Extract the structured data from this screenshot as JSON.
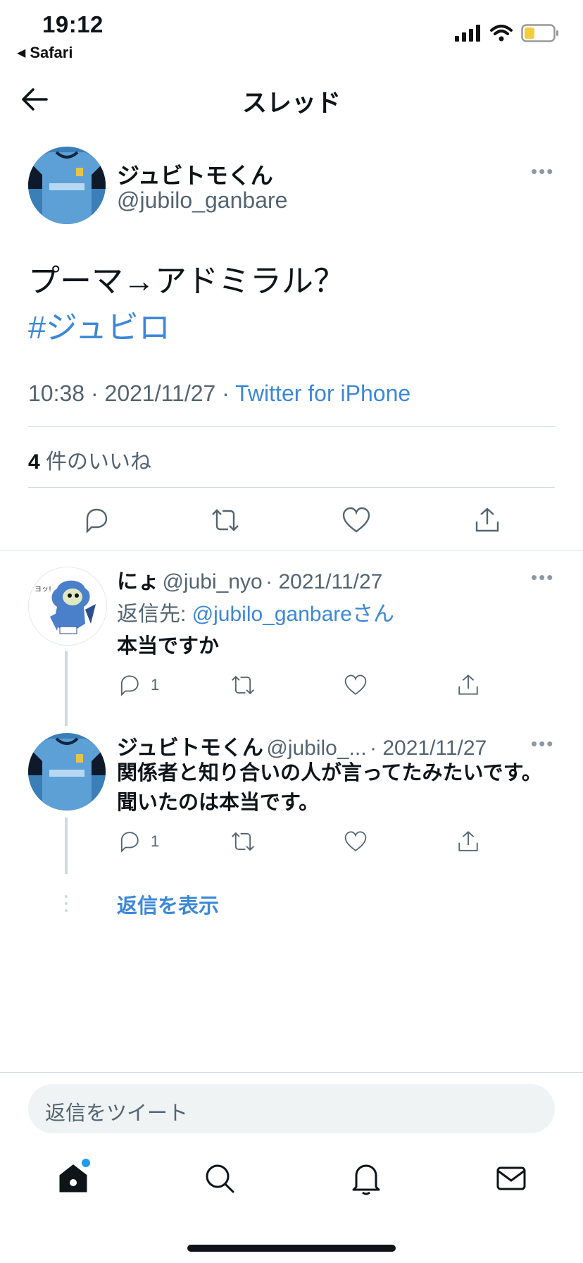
{
  "status_bar": {
    "time": "19:12",
    "back_app": "Safari",
    "icons": [
      "signal-icon",
      "wifi-icon",
      "battery-icon"
    ]
  },
  "header": {
    "title": "スレッド",
    "back_icon": "arrow-left-icon"
  },
  "main_tweet": {
    "display_name": "ジュビトモくん",
    "handle": "@jubilo_ganbare",
    "text": "プーマ→アドミラル？",
    "hashtag": "#ジュビロ",
    "time": "10:38",
    "date": "2021/11/27",
    "source": "Twitter for iPhone",
    "likes_count": "4",
    "likes_label": "件のいいね",
    "actions": [
      "reply-icon",
      "retweet-icon",
      "like-icon",
      "share-icon"
    ]
  },
  "replies": [
    {
      "display_name": "にょ",
      "handle": "@jubi_nyo",
      "date": "· 2021/11/27",
      "reply_to_label": "返信先:",
      "reply_to_handle": "@jubilo_ganbare",
      "reply_to_suffix": "さん",
      "text": "本当ですか",
      "reply_count": "1"
    },
    {
      "display_name": "ジュビトモくん",
      "handle": "@jubilo_...",
      "date": "· 2021/11/27",
      "text_line1": "関係者と知り合いの人が言ってたみたいです。",
      "text_line2": "聞いたのは本当です。",
      "reply_count": "1"
    }
  ],
  "show_replies_label": "返信を表示",
  "reply_placeholder": "返信をツイート",
  "tab_bar": [
    "home-icon",
    "search-icon",
    "bell-icon",
    "mail-icon"
  ],
  "colors": {
    "link": "#3b88d8",
    "muted": "#536471",
    "notification_dot": "#1d9bf0"
  }
}
